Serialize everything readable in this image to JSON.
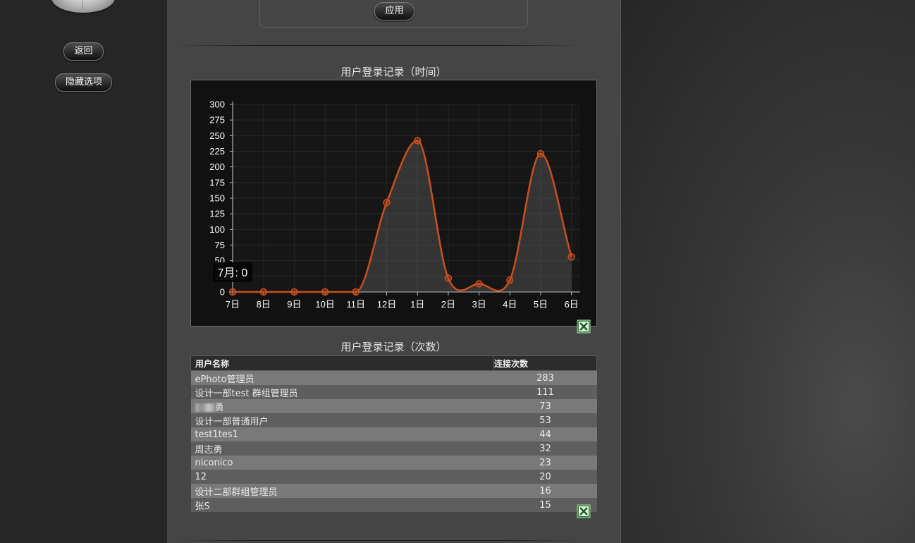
{
  "sidebar": {
    "back_label": "返回",
    "hide_options_label": "隐藏选项"
  },
  "filter": {
    "apply_label": "应用"
  },
  "login_time_chart": {
    "title": "用户登录记录（时间）",
    "tooltip": "7月: 0",
    "chart_data": {
      "type": "area",
      "categories": [
        "7日",
        "8日",
        "9日",
        "10日",
        "11日",
        "12日",
        "1日",
        "2日",
        "3日",
        "4日",
        "5日",
        "6日"
      ],
      "values": [
        0,
        0,
        0,
        0,
        0,
        143,
        242,
        22,
        13,
        19,
        221,
        56
      ],
      "y_ticks": [
        0,
        25,
        50,
        75,
        100,
        125,
        150,
        175,
        200,
        225,
        250,
        275,
        300
      ],
      "ylim": [
        0,
        300
      ],
      "line_color": "#c9501c",
      "grid": true
    }
  },
  "login_count_table": {
    "title": "用户登录记录（次数）",
    "columns": [
      "用户名称",
      "连接次数"
    ],
    "rows": [
      {
        "name": "ePhoto管理员",
        "count": "283"
      },
      {
        "name": "设计一部test 群组管理员",
        "count": "111"
      },
      {
        "name": "勇",
        "count": "73",
        "blurred_prefix": true
      },
      {
        "name": "设计一部普通用户",
        "count": "53"
      },
      {
        "name": "test1tes1",
        "count": "44"
      },
      {
        "name": "周志勇",
        "count": "32"
      },
      {
        "name": "niconico",
        "count": "23"
      },
      {
        "name": "12",
        "count": "20"
      },
      {
        "name": "设计二部群组管理员",
        "count": "16"
      },
      {
        "name": "张S",
        "count": "15"
      }
    ]
  },
  "icons": {
    "export": "excel-export-icon"
  }
}
